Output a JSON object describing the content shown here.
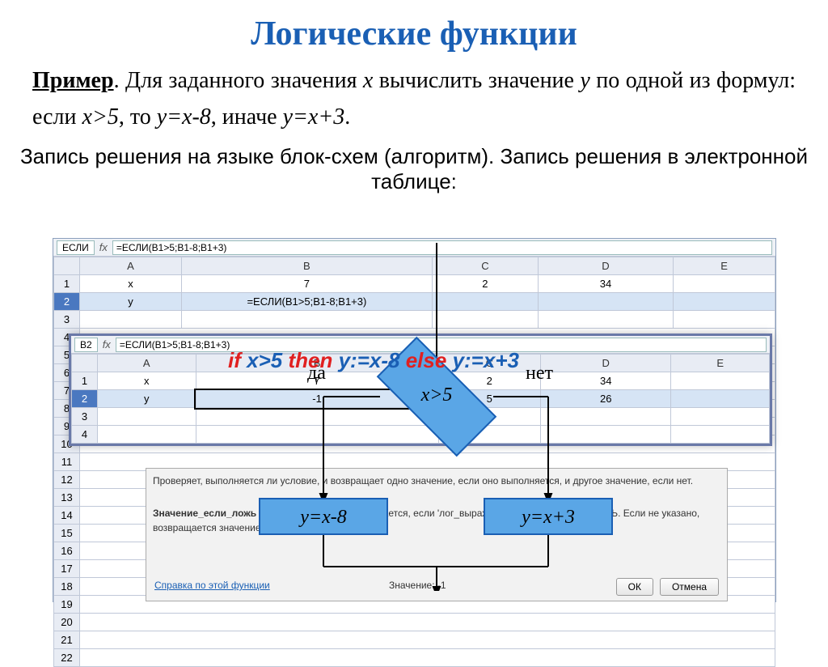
{
  "title": "Логические функции",
  "example": {
    "label": "Пример",
    "text_1": ". Для заданного значения ",
    "var_x": "x",
    "text_2": " вычислить значение ",
    "var_y": "y",
    "text_3": " по одной из формул: если ",
    "cond": "x>5",
    "text_4": ", то ",
    "then": "y=x-8",
    "text_5": ", иначе ",
    "else": "y=x+3",
    "text_6": "."
  },
  "heading": "Запись решения на языке блок-схем (алгоритм). Запись решения в электронной таблице:",
  "ss1": {
    "namebox": "ЕСЛИ",
    "formula": "=ЕСЛИ(B1>5;B1-8;B1+3)",
    "cols": [
      "A",
      "B",
      "C",
      "D",
      "E"
    ],
    "rows": [
      {
        "n": "1",
        "a": "x",
        "b": "7",
        "c": "2",
        "d": "34",
        "e": ""
      },
      {
        "n": "2",
        "a": "y",
        "b": "=ЕСЛИ(B1>5;B1-8;B1+3)",
        "c": "",
        "d": "",
        "e": ""
      },
      {
        "n": "3"
      },
      {
        "n": "4"
      },
      {
        "n": "5"
      },
      {
        "n": "6"
      },
      {
        "n": "7"
      },
      {
        "n": "8"
      },
      {
        "n": "9"
      },
      {
        "n": "10"
      },
      {
        "n": "11"
      },
      {
        "n": "12"
      },
      {
        "n": "13"
      },
      {
        "n": "14"
      },
      {
        "n": "15"
      },
      {
        "n": "16"
      },
      {
        "n": "17"
      },
      {
        "n": "18"
      },
      {
        "n": "19"
      },
      {
        "n": "20"
      },
      {
        "n": "21"
      },
      {
        "n": "22"
      }
    ]
  },
  "ss2": {
    "cell": "B2",
    "formula": "=ЕСЛИ(B1>5;B1-8;B1+3)",
    "cols": [
      "A",
      "B",
      "C",
      "D",
      "E"
    ],
    "rows": [
      {
        "n": "1",
        "a": "x",
        "b": "7",
        "c": "2",
        "d": "34",
        "e": ""
      },
      {
        "n": "2",
        "a": "y",
        "b": "-1",
        "c": "5",
        "d": "26",
        "e": ""
      },
      {
        "n": "3"
      },
      {
        "n": "4"
      }
    ]
  },
  "code": {
    "if": "if",
    "cond": "x>5",
    "then": "then",
    "t": "y:=x-8",
    "else": "else",
    "e": "y:=x+3"
  },
  "flow": {
    "yes": "да",
    "no": "нет",
    "cond": "x>5",
    "left": "y=x-8",
    "right": "y=x+3"
  },
  "help": {
    "line1": "Проверяет, выполняется ли условие, и возвращает одно значение, если оно выполняется, и другое значение, если нет.",
    "bold": "Значение_если_ложь",
    "line2a": "значение, которое возвращается, если 'лог_выражение' имеет значение ЛОЖЬ. Если не указано, возвращается значение ЛОЖЬ.",
    "link": "Справка по этой функции",
    "value_label": "Значение:",
    "value": "-1",
    "ok": "ОК",
    "cancel": "Отмена"
  }
}
